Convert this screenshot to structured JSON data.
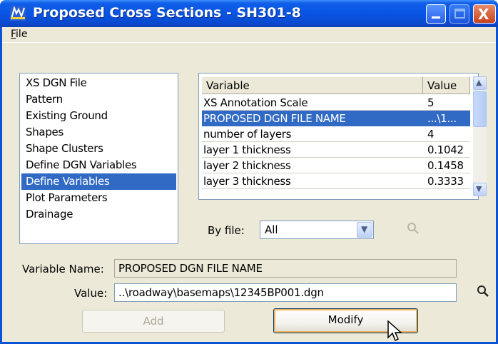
{
  "window": {
    "title": "Proposed Cross Sections - SH301-8",
    "close_glyph": "X"
  },
  "menu": {
    "file_underlined": "F",
    "file_rest": "ile"
  },
  "left_list": {
    "items": [
      {
        "label": "XS DGN File",
        "selected": false
      },
      {
        "label": "Pattern",
        "selected": false
      },
      {
        "label": "Existing Ground",
        "selected": false
      },
      {
        "label": "Shapes",
        "selected": false
      },
      {
        "label": "Shape Clusters",
        "selected": false
      },
      {
        "label": "Define DGN Variables",
        "selected": false
      },
      {
        "label": "Define Variables",
        "selected": true
      },
      {
        "label": "Plot Parameters",
        "selected": false
      },
      {
        "label": "Drainage",
        "selected": false
      }
    ]
  },
  "grid": {
    "columns": [
      "Variable",
      "Value"
    ],
    "rows": [
      {
        "variable": "XS Annotation Scale",
        "value": "5",
        "selected": false
      },
      {
        "variable": "PROPOSED DGN FILE NAME",
        "value": "...\\1...",
        "selected": true
      },
      {
        "variable": "number of layers",
        "value": "4",
        "selected": false
      },
      {
        "variable": "layer 1 thickness",
        "value": "0.1042",
        "selected": false
      },
      {
        "variable": "layer 2 thickness",
        "value": "0.1458",
        "selected": false
      },
      {
        "variable": "layer 3 thickness",
        "value": "0.3333",
        "selected": false
      }
    ]
  },
  "filter": {
    "label": "By file:",
    "value": "All"
  },
  "form": {
    "variable_name_label": "Variable Name:",
    "variable_name_value": "PROPOSED DGN FILE NAME",
    "value_label": "Value:",
    "value_value": "..\\roadway\\basemaps\\12345BP001.dgn"
  },
  "buttons": {
    "add": "Add",
    "modify": "Modify"
  },
  "colors": {
    "title_bar": "#0854e3",
    "selection": "#316ac5",
    "window_bg": "#ece9d8"
  }
}
